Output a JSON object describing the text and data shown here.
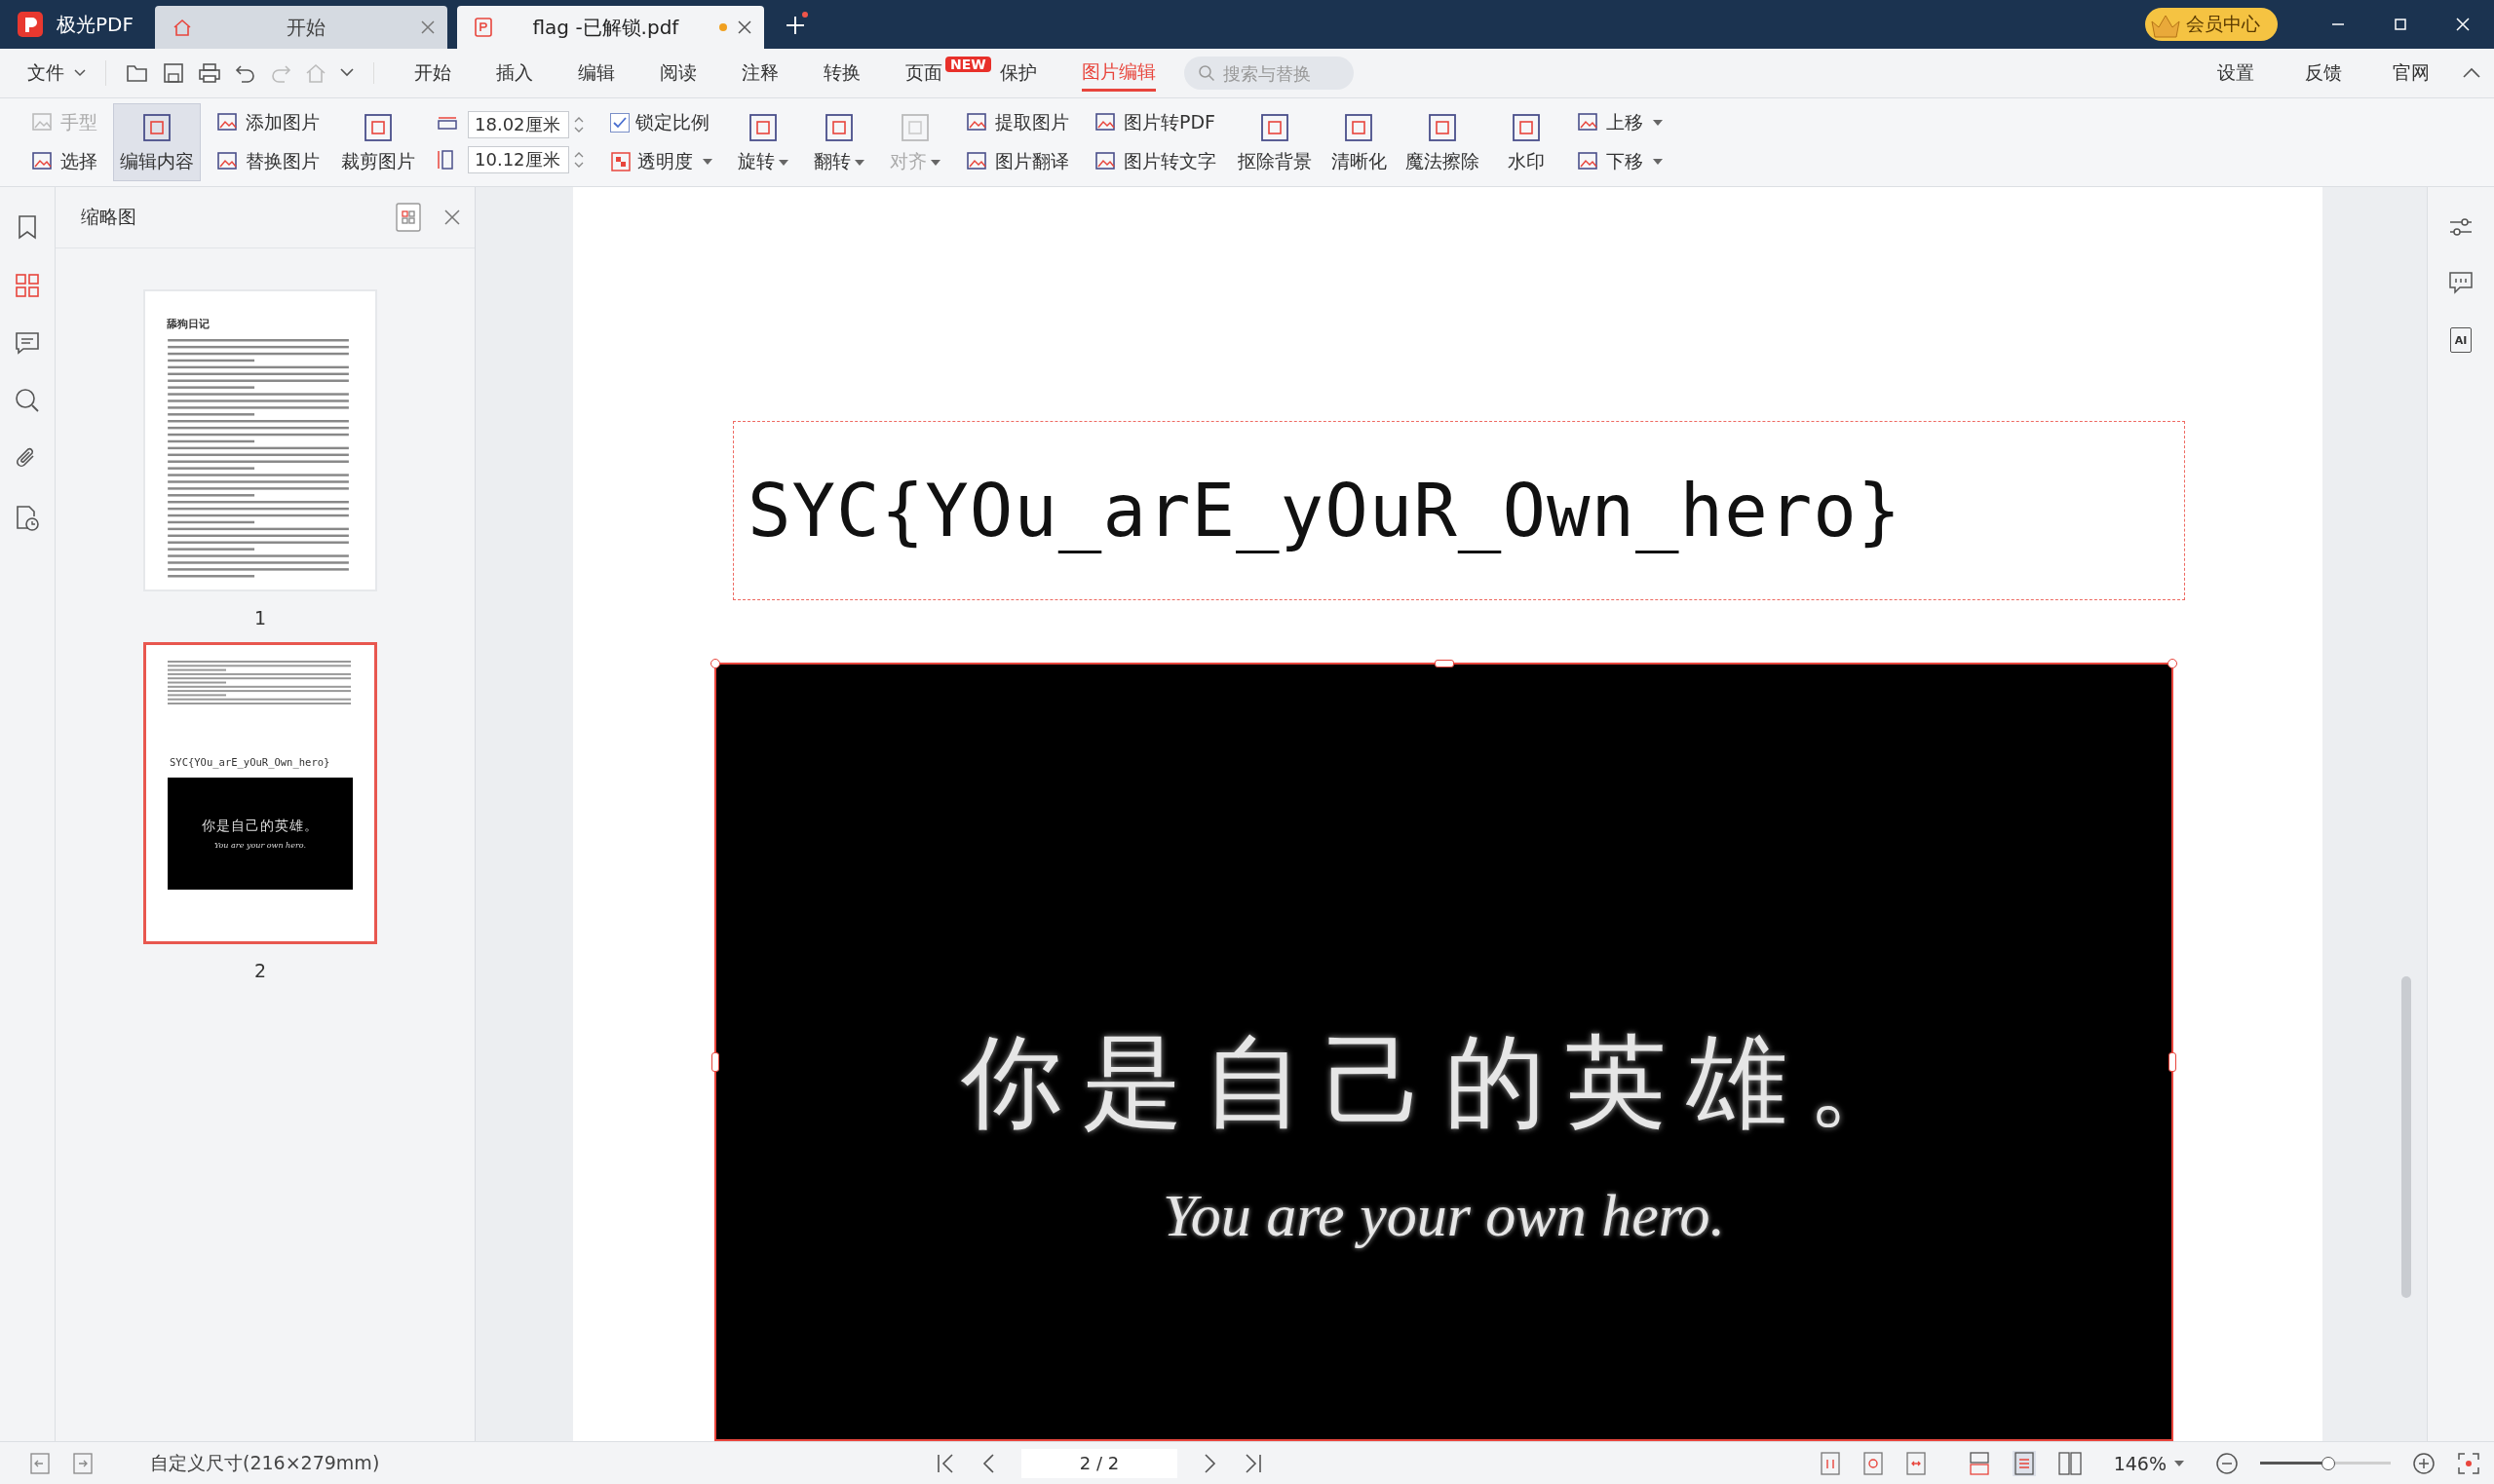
{
  "app": {
    "name": "极光PDF"
  },
  "tabs": [
    {
      "label": "开始",
      "kind": "home",
      "selected": false
    },
    {
      "label": "flag -已解锁.pdf",
      "kind": "file",
      "selected": true,
      "modified": true
    }
  ],
  "vip": {
    "label": "会员中心"
  },
  "menu": {
    "file": "文件",
    "items": [
      {
        "label": "开始",
        "selected": false
      },
      {
        "label": "插入",
        "selected": false
      },
      {
        "label": "编辑",
        "selected": false
      },
      {
        "label": "阅读",
        "selected": false
      },
      {
        "label": "注释",
        "selected": false
      },
      {
        "label": "转换",
        "selected": false
      },
      {
        "label": "页面",
        "badge": "NEW",
        "selected": false
      },
      {
        "label": "保护",
        "selected": false
      },
      {
        "label": "图片编辑",
        "selected": true
      }
    ],
    "search": {
      "placeholder": "搜索与替换"
    },
    "right": [
      "设置",
      "反馈",
      "官网"
    ]
  },
  "toolbar": [
    {
      "kind": "stack",
      "items": [
        {
          "label": "手型",
          "disabled": true
        },
        {
          "label": "选择",
          "disabled": false
        }
      ]
    },
    {
      "kind": "big",
      "label": "编辑内容",
      "selected": true
    },
    {
      "kind": "stack",
      "items": [
        {
          "label": "添加图片",
          "disabled": false
        },
        {
          "label": "替换图片",
          "disabled": false
        }
      ]
    },
    {
      "kind": "big",
      "label": "裁剪图片",
      "selected": false
    },
    {
      "kind": "fields",
      "items": [
        {
          "value": "18.02厘米"
        },
        {
          "value": "10.12厘米"
        }
      ]
    },
    {
      "kind": "options",
      "checkbox": {
        "label": "锁定比例",
        "checked": true
      },
      "dropdown": {
        "label": "透明度"
      }
    },
    {
      "kind": "big",
      "label": "旋转",
      "dropdown": true,
      "selected": false
    },
    {
      "kind": "big",
      "label": "翻转",
      "dropdown": true,
      "selected": false
    },
    {
      "kind": "big",
      "label": "对齐",
      "dropdown": true,
      "disabled": true,
      "selected": false
    },
    {
      "kind": "stack",
      "items": [
        {
          "label": "提取图片",
          "disabled": false
        },
        {
          "label": "图片翻译",
          "disabled": false
        }
      ]
    },
    {
      "kind": "stack",
      "items": [
        {
          "label": "图片转PDF",
          "disabled": false
        },
        {
          "label": "图片转文字",
          "disabled": false
        }
      ]
    },
    {
      "kind": "big",
      "label": "抠除背景",
      "selected": false
    },
    {
      "kind": "big",
      "label": "清晰化",
      "selected": false
    },
    {
      "kind": "big",
      "label": "魔法擦除",
      "selected": false
    },
    {
      "kind": "big",
      "label": "水印",
      "selected": false
    },
    {
      "kind": "stack",
      "items": [
        {
          "label": "上移",
          "dropdown": true,
          "disabled": false
        },
        {
          "label": "下移",
          "dropdown": true,
          "disabled": false
        }
      ]
    }
  ],
  "sidebar": {
    "items": [
      {
        "selected": false
      },
      {
        "selected": true
      },
      {
        "selected": false
      },
      {
        "selected": false
      },
      {
        "selected": false
      },
      {
        "selected": false
      }
    ]
  },
  "thumbnails": {
    "title": "缩略图",
    "pages": [
      {
        "number": "1",
        "title": "舔狗日记",
        "selected": false
      },
      {
        "number": "2",
        "flag": "SYC{YOu_arE_yOuR_Own_hero}",
        "caption": "你是自己的英雄。",
        "subcaption": "You are your own hero.",
        "selected": true
      }
    ]
  },
  "document": {
    "flag": "SYC{YOu_arE_yOuR_Own_hero}",
    "image_caption": "你是自己的英雄。",
    "image_subcaption": "You are your own hero."
  },
  "right_panel": {
    "ai_label": "AI"
  },
  "status_bar": {
    "page_size": "自定义尺寸(216×279mm)",
    "page": "2 / 2",
    "zoom": "146%",
    "zoom_slider": {
      "level": 0.52
    }
  }
}
